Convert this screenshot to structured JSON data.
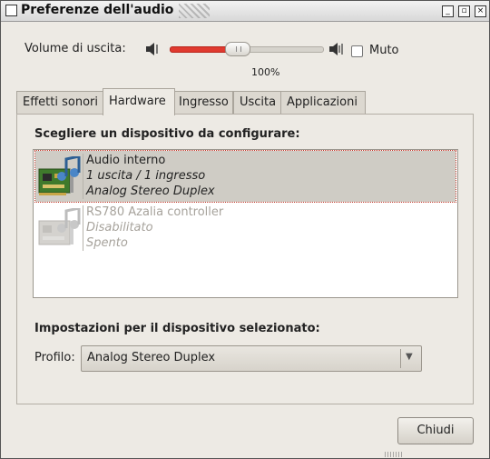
{
  "window": {
    "title": "Preferenze dell'audio"
  },
  "volume": {
    "label": "Volume di uscita:",
    "percent_label": "100%",
    "level": 0.44
  },
  "mute": {
    "label": "Muto",
    "checked": false
  },
  "tabs": [
    {
      "label": "Effetti sonori",
      "active": false
    },
    {
      "label": "Hardware",
      "active": true
    },
    {
      "label": "Ingresso",
      "active": false
    },
    {
      "label": "Uscita",
      "active": false
    },
    {
      "label": "Applicazioni",
      "active": false
    }
  ],
  "hardware": {
    "device_heading": "Scegliere un dispositivo da configurare:",
    "devices": [
      {
        "name": "Audio interno",
        "ports": "1 uscita / 1 ingresso",
        "profile": "Analog Stereo Duplex",
        "selected": true,
        "icon": "audio-card-icon"
      },
      {
        "name": "RS780 Azalia controller",
        "ports": "Disabilitato",
        "profile": "Spento",
        "selected": false,
        "icon": "audio-card-icon"
      }
    ],
    "settings_heading": "Impostazioni per il dispositivo selezionato:",
    "profile_label": "Profilo:",
    "profile_value": "Analog Stereo Duplex"
  },
  "buttons": {
    "close": "Chiudi"
  },
  "colors": {
    "slider_fill": "#e03a2f",
    "selection_bg": "#cfccc5"
  }
}
